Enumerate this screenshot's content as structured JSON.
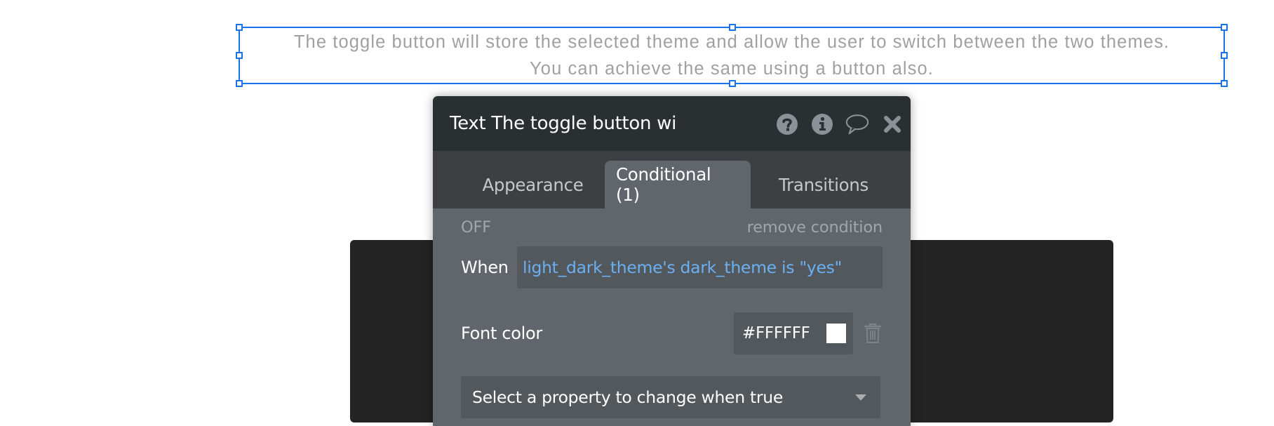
{
  "canvas": {
    "text_element": {
      "line1": "The toggle button will store the selected theme and allow the user to switch between the two themes.",
      "line2": "You can achieve the same using a button also."
    }
  },
  "editor": {
    "title": "Text The toggle button wi",
    "icons": [
      "help-icon",
      "info-icon",
      "comment-icon",
      "close-icon"
    ],
    "tabs": [
      {
        "label": "Appearance",
        "active": false
      },
      {
        "label": "Conditional (1)",
        "active": true
      },
      {
        "label": "Transitions",
        "active": false
      }
    ],
    "condition": {
      "status": "OFF",
      "remove_label": "remove condition",
      "when_label": "When",
      "expression": "light_dark_theme's dark_theme is \"yes\""
    },
    "properties": [
      {
        "label": "Font color",
        "value": "#FFFFFF",
        "swatch_color": "#FFFFFF"
      }
    ],
    "add_property_placeholder": "Select a property to change when true"
  },
  "colors": {
    "selection": "#1a73e8",
    "expression_text": "#6ab0f3",
    "header_bg": "#2a2f32",
    "panel_bg": "#60666b"
  }
}
